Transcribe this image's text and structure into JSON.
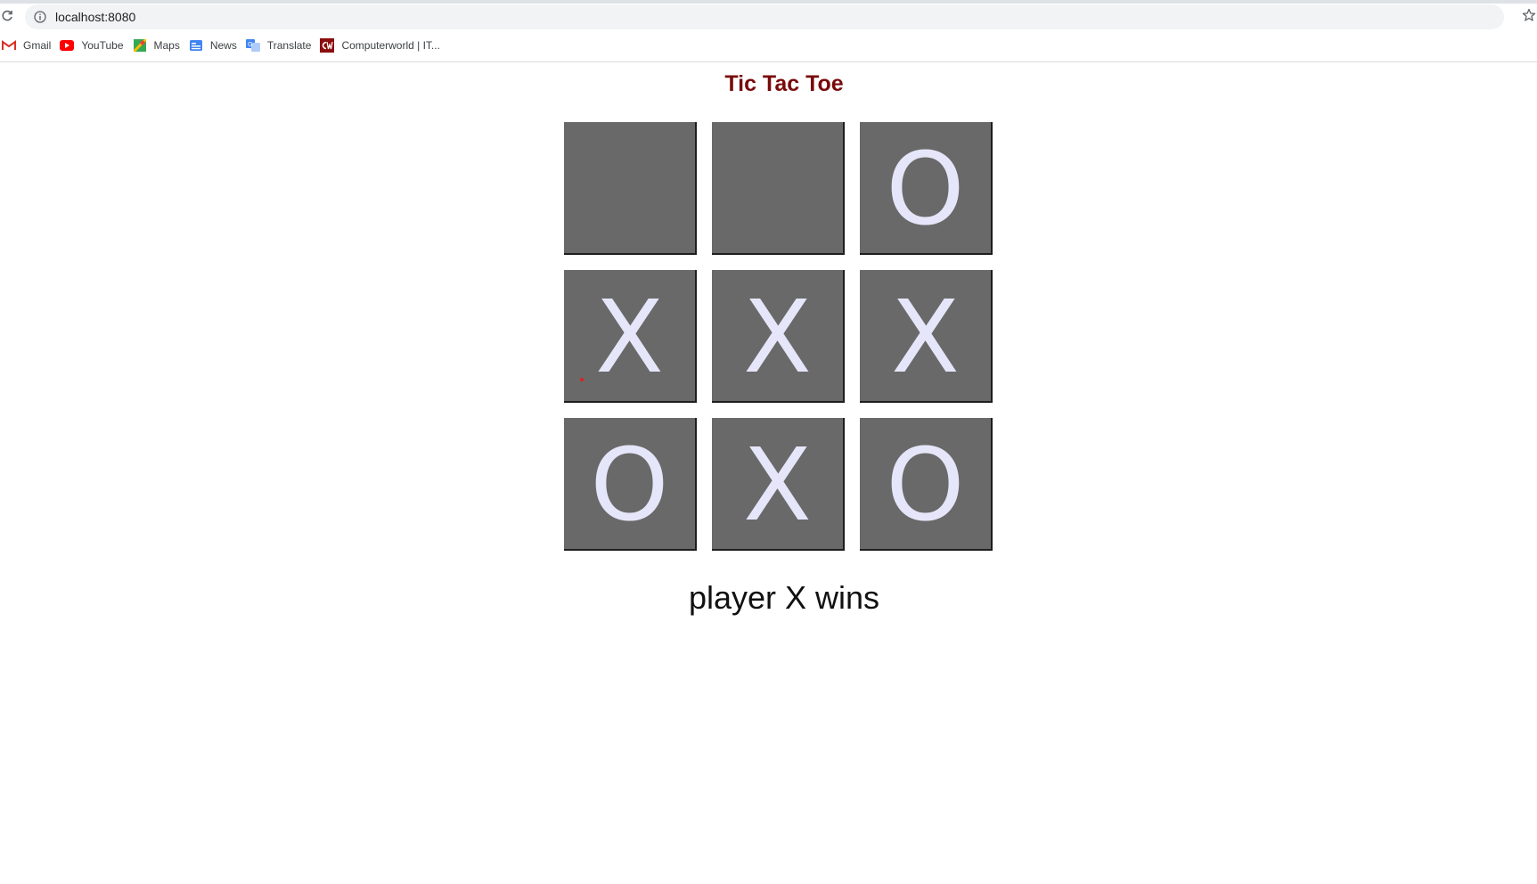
{
  "browser": {
    "url": "localhost:8080",
    "bookmarks": [
      {
        "label": "Gmail",
        "icon": "gmail-icon"
      },
      {
        "label": "YouTube",
        "icon": "youtube-icon"
      },
      {
        "label": "Maps",
        "icon": "maps-icon"
      },
      {
        "label": "News",
        "icon": "news-icon"
      },
      {
        "label": "Translate",
        "icon": "translate-icon"
      },
      {
        "label": "Computerworld | IT...",
        "icon": "computerworld-icon"
      }
    ]
  },
  "game": {
    "title": "Tic Tac Toe",
    "board": [
      [
        "",
        "",
        "O"
      ],
      [
        "X",
        "X",
        "X"
      ],
      [
        "O",
        "X",
        "O"
      ]
    ],
    "status": "player X wins"
  },
  "colors": {
    "title": "#7a0a0a",
    "cell_bg": "#696969",
    "mark": "#e6e6fa"
  }
}
